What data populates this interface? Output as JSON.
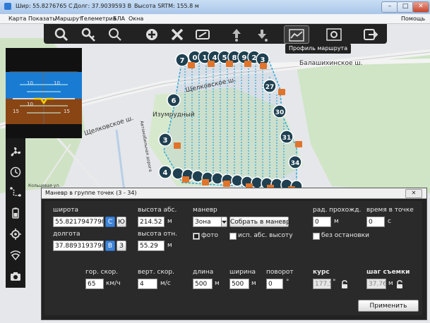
{
  "titlebar": {
    "lat": "Шир: 55.8276765 С",
    "lon": "Долг: 37.9039593 В",
    "alt": "Высота SRTM: 155.8 м",
    "minimize": "–",
    "maximize": "□",
    "close": "✕"
  },
  "menu": {
    "items": [
      "Карта",
      "Показать",
      "Маршрут",
      "Телеметрия",
      "БЛА",
      "Окна"
    ],
    "help": "Помощь"
  },
  "toolbar": {
    "tooltip": "Профиль маршрута",
    "buttons": [
      "zoom-out-icon",
      "zoom-key-icon",
      "zoom-in-icon",
      "add-point-icon",
      "tools-icon",
      "camera-edit-icon",
      "move-up-icon",
      "move-down-icon",
      "route-profile-icon",
      "settings-icon",
      "exit-icon"
    ]
  },
  "map": {
    "labels": [
      "Балашихинское ш.",
      "Щелковское ш.",
      "Щелковское ш.",
      "Изумрудный",
      "Автомобильная дорога",
      "Кольцевая ул."
    ],
    "waypoints_top": [
      "7",
      "0",
      "1",
      "4",
      "5",
      "8",
      "9",
      "2",
      "3",
      "6"
    ],
    "waypoints_side": [
      "6",
      "27",
      "30",
      "3",
      "31",
      "34",
      "4"
    ]
  },
  "instrument": {
    "pitch_marks": [
      "10",
      "10",
      "10",
      "15",
      "15"
    ]
  },
  "dialog": {
    "title": "Маневр в группе точек (3 - 34)",
    "close": "✕",
    "lat_label": "широта",
    "lat_value": "55.8217947790",
    "lat_btn1": "С",
    "lat_btn2": "Ю",
    "lon_label": "долгота",
    "lon_value": "37.8893193790",
    "lon_btn1": "В",
    "lon_btn2": "З",
    "alt_abs_label": "высота абс.",
    "alt_abs_value": "214.52",
    "alt_rel_label": "высота отн.",
    "alt_rel_value": "55.29",
    "m": "м",
    "hspeed_label": "гор. скор.",
    "hspeed_value": "65",
    "hspeed_unit": "км/ч",
    "vspeed_label": "верт. скор.",
    "vspeed_value": "4",
    "vspeed_unit": "м/с",
    "maneuver_label": "маневр",
    "maneuver_value": "Зона",
    "collect_btn": "Собрать в маневр",
    "photo_label": "фото",
    "abs_alt_label": "исп. абс. высоту",
    "length_label": "длина",
    "length_value": "500",
    "width_label": "ширина",
    "width_value": "500",
    "turn_label": "поворот",
    "turn_value": "0",
    "deg": "°",
    "radius_label": "рад. прохожд.",
    "radius_value": "0",
    "time_label": "время в точке",
    "time_value": "0",
    "sec": "с",
    "nostop_label": "без остановки",
    "course_label": "курс",
    "course_value": "177.5",
    "step_label": "шаг съемки",
    "step_value": "37.76",
    "apply_btn": "Применить"
  }
}
